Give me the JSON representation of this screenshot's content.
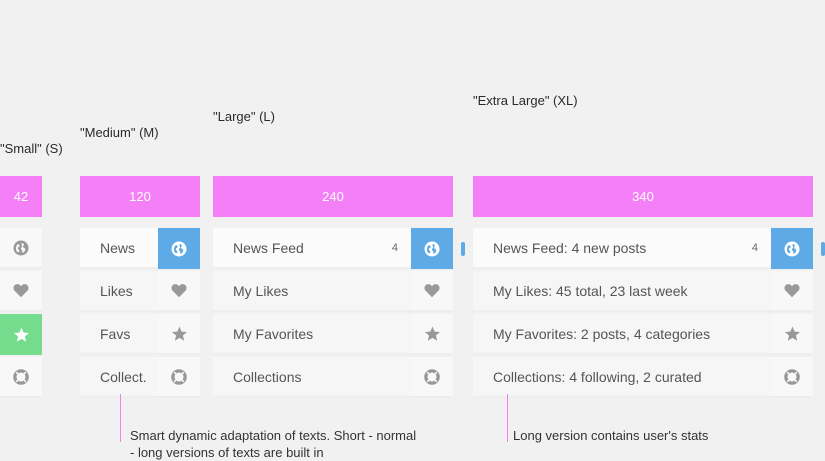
{
  "sizes": {
    "small": {
      "label": "\"Small\" (S)",
      "bar_value": "42"
    },
    "medium": {
      "label": "\"Medium\" (M)",
      "bar_value": "120",
      "items": [
        "News",
        "Likes",
        "Favs",
        "Collect."
      ]
    },
    "large": {
      "label": "\"Large\" (L)",
      "bar_value": "240",
      "items": [
        "News Feed",
        "My Likes",
        "My Favorites",
        "Collections"
      ],
      "news_count": "4"
    },
    "xl": {
      "label": "\"Extra Large\" (XL)",
      "bar_value": "340",
      "items": [
        "News Feed: 4 new posts",
        "My Likes: 45 total, 23 last week",
        "My Favorites: 2 posts, 4 categories",
        "Collections: 4 following, 2 curated"
      ],
      "news_count": "4"
    }
  },
  "notes": {
    "adaptation": "Smart dynamic adaptation of texts. Short - normal - long versions of texts are built in",
    "long_version": "Long version contains user's stats"
  },
  "icons": [
    "globe-icon",
    "heart-icon",
    "star-icon",
    "lifebuoy-icon"
  ],
  "colors": {
    "accent_pink": "#f57ff6",
    "active_blue": "#5eaae6",
    "active_green": "#74dc8c",
    "icon_gray": "#999999"
  }
}
